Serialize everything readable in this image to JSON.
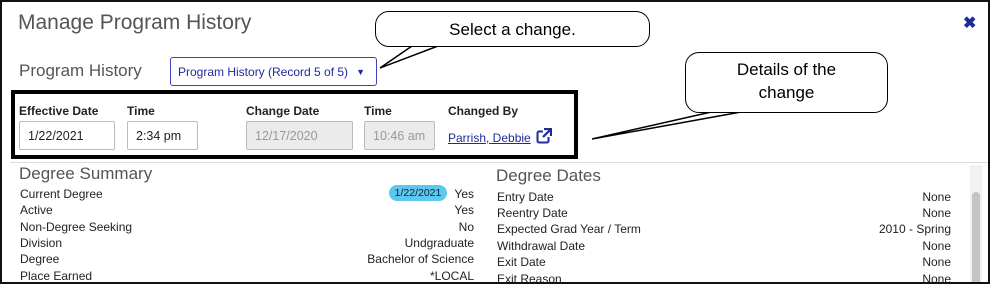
{
  "dialog": {
    "title": "Manage Program History",
    "close_glyph": "✖"
  },
  "program_history": {
    "label": "Program History",
    "selected": "Program History (Record 5 of 5)",
    "caret": "▼"
  },
  "change_fields": {
    "effective_date_label": "Effective Date",
    "effective_date": "1/22/2021",
    "time_label": "Time",
    "time": "2:34 pm",
    "change_date_label": "Change Date",
    "change_date": "12/17/2020",
    "change_time_label": "Time",
    "change_time": "10:46 am",
    "changed_by_label": "Changed By",
    "changed_by": "Parrish, Debbie"
  },
  "callouts": {
    "select_change": "Select a change.",
    "details_line1": "Details of the",
    "details_line2": "change"
  },
  "degree_summary": {
    "title": "Degree Summary",
    "badge": "1/22/2021",
    "rows": [
      {
        "label": "Current Degree",
        "value": "Yes"
      },
      {
        "label": "Active",
        "value": "Yes"
      },
      {
        "label": "Non-Degree Seeking",
        "value": "No"
      },
      {
        "label": "Division",
        "value": "Undgraduate"
      },
      {
        "label": "Degree",
        "value": "Bachelor of Science"
      },
      {
        "label": "Place Earned",
        "value": "*LOCAL"
      }
    ]
  },
  "degree_dates": {
    "title": "Degree Dates",
    "rows": [
      {
        "label": "Entry Date",
        "value": "None"
      },
      {
        "label": "Reentry Date",
        "value": "None"
      },
      {
        "label": "Expected Grad Year / Term",
        "value": "2010 - Spring"
      },
      {
        "label": "Withdrawal Date",
        "value": "None"
      },
      {
        "label": "Exit Date",
        "value": "None"
      },
      {
        "label": "Exit Reason",
        "value": "None"
      }
    ]
  },
  "colors": {
    "link": "#1f2a9e",
    "badge": "#5bc8ee",
    "annotation_border": "#000000"
  }
}
